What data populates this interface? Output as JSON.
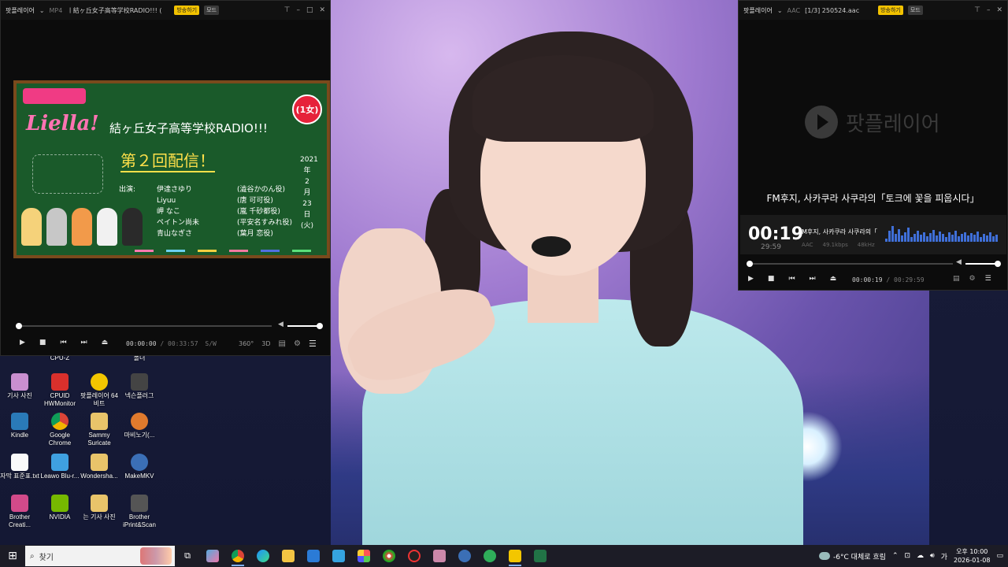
{
  "video_player": {
    "app_name": "팟플레이어",
    "format": "MP4",
    "file_title": "ㅣ結ヶ丘女子高等学校RADIO!!! (",
    "live_badge": "방송하기",
    "mode_badge": "모드",
    "elapsed": "00:00:00",
    "duration": "00:33:57",
    "speed_label": "S/W",
    "view_labels": [
      "360°",
      "3D"
    ],
    "progress": 0.0,
    "volume": 1.0,
    "video": {
      "brand": "Liella!",
      "radio_title": "結ヶ丘女子高等学校RADIO!!!",
      "episode": "第２回配信！",
      "badge": "(1女)",
      "date_vertical": [
        "2021",
        "年",
        "2",
        "月",
        "23",
        "日",
        "(火)"
      ],
      "cast_heading": "出演:",
      "cast": [
        {
          "who": "伊達さゆり",
          "role": "(澁谷かのん役)"
        },
        {
          "who": "Liyuu",
          "role": "(唐 可可役)"
        },
        {
          "who": "岬 なこ",
          "role": "(嵐 千砂都役)"
        },
        {
          "who": "ペイトン尚未",
          "role": "(平安名すみれ役)"
        },
        {
          "who": "青山なぎさ",
          "role": "(葉月 恋役)"
        }
      ]
    }
  },
  "audio_player": {
    "app_name": "팟플레이어",
    "format": "AAC",
    "file_title": "[1/3] 250524.aac",
    "live_badge": "방송하기",
    "mode_badge": "모드",
    "logo_text": "팟플레이어",
    "lyric": "FM후지, 사카쿠라 사쿠라의「토크에 꽃을 피웁시다」",
    "big_time": "00:19",
    "remaining": "29:59",
    "track_line": "M후지, 사카쿠라 사쿠라의「",
    "meta": [
      "AAC",
      "49.1kbps",
      "48kHz"
    ],
    "elapsed": "00:00:19",
    "duration": "00:29:59",
    "progress": 0.011,
    "volume": 1.0
  },
  "desktop_icons": [
    {
      "label": "CPU-Z"
    },
    {
      "label": "기사 사진"
    },
    {
      "label": "CPUID HWMonitor"
    },
    {
      "label": "팟플레이어 64 비트"
    },
    {
      "label": "넥슨플러그"
    },
    {
      "label": "Kindle"
    },
    {
      "label": "Google Chrome"
    },
    {
      "label": "Sammy Suricate"
    },
    {
      "label": "마비노기(..."
    },
    {
      "label": "자막 표준표.txt"
    },
    {
      "label": "Leawo Blu-r..."
    },
    {
      "label": "Wondersha..."
    },
    {
      "label": "MakeMKV"
    },
    {
      "label": "Brother Creati..."
    },
    {
      "label": "NVIDIA"
    },
    {
      "label": "는 기사 사진"
    },
    {
      "label": "Brother iPrint&Scan"
    },
    {
      "label": "정리"
    },
    {
      "label": "폴더"
    }
  ],
  "taskbar": {
    "search_placeholder": "찾기",
    "weather": "-6°C  대체로 흐림",
    "time": "오후 10:00",
    "date": "2026-01-08",
    "ime": "가"
  },
  "colors": {
    "live_badge": "#f2c200",
    "spectrum": "#3f6fd8",
    "chalkboard": "#1a5a2a",
    "brand_pink": "#ff73b3"
  }
}
